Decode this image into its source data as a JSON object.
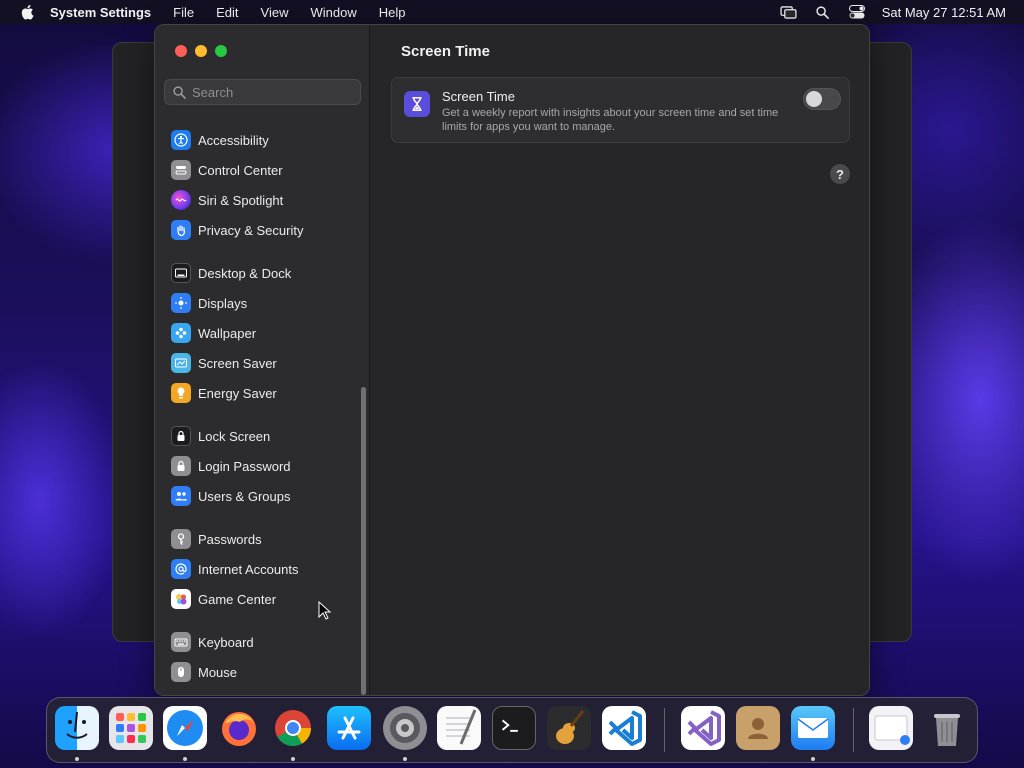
{
  "menubar": {
    "app_name": "System Settings",
    "menus": [
      "File",
      "Edit",
      "View",
      "Window",
      "Help"
    ],
    "clock": "Sat May 27  12:51 AM"
  },
  "search": {
    "placeholder": "Search"
  },
  "sidebar": {
    "items": [
      {
        "label": "Accessibility",
        "icon": "accessibility-icon",
        "color": "#1e7cf2"
      },
      {
        "label": "Control Center",
        "icon": "control-center-icon",
        "color": "#8e8e93"
      },
      {
        "label": "Siri & Spotlight",
        "icon": "siri-icon",
        "color": "#c03ad8"
      },
      {
        "label": "Privacy & Security",
        "icon": "hand-icon",
        "color": "#2f7ef5"
      },
      {
        "label": "Desktop & Dock",
        "icon": "desktop-dock-icon",
        "color": "#1c1c1e"
      },
      {
        "label": "Displays",
        "icon": "displays-icon",
        "color": "#2f7ef5"
      },
      {
        "label": "Wallpaper",
        "icon": "wallpaper-icon",
        "color": "#38a6f0"
      },
      {
        "label": "Screen Saver",
        "icon": "screen-saver-icon",
        "color": "#4ab5e8"
      },
      {
        "label": "Energy Saver",
        "icon": "energy-saver-icon",
        "color": "#f5a623"
      },
      {
        "label": "Lock Screen",
        "icon": "lock-screen-icon",
        "color": "#1c1c1e"
      },
      {
        "label": "Login Password",
        "icon": "lock-icon",
        "color": "#8e8e93"
      },
      {
        "label": "Users & Groups",
        "icon": "users-icon",
        "color": "#2f7ef5"
      },
      {
        "label": "Passwords",
        "icon": "key-icon",
        "color": "#8e8e93"
      },
      {
        "label": "Internet Accounts",
        "icon": "at-icon",
        "color": "#2f7ef5"
      },
      {
        "label": "Game Center",
        "icon": "game-center-icon",
        "color": "#ffffff"
      },
      {
        "label": "Keyboard",
        "icon": "keyboard-icon",
        "color": "#8e8e93"
      },
      {
        "label": "Mouse",
        "icon": "mouse-icon",
        "color": "#8e8e93"
      }
    ]
  },
  "content": {
    "title": "Screen Time",
    "card": {
      "title": "Screen Time",
      "description": "Get a weekly report with insights about your screen time and set time limits for apps you want to manage.",
      "toggle_on": false
    },
    "help_label": "?"
  },
  "dock": {
    "apps": [
      "Finder",
      "Launchpad",
      "Safari",
      "Firefox",
      "Chrome",
      "App Store",
      "System Settings",
      "TextEdit",
      "Terminal",
      "GarageBand",
      "Visual Studio Code",
      "Visual Studio",
      "Contacts",
      "Mail",
      "Preview",
      "Trash"
    ]
  }
}
